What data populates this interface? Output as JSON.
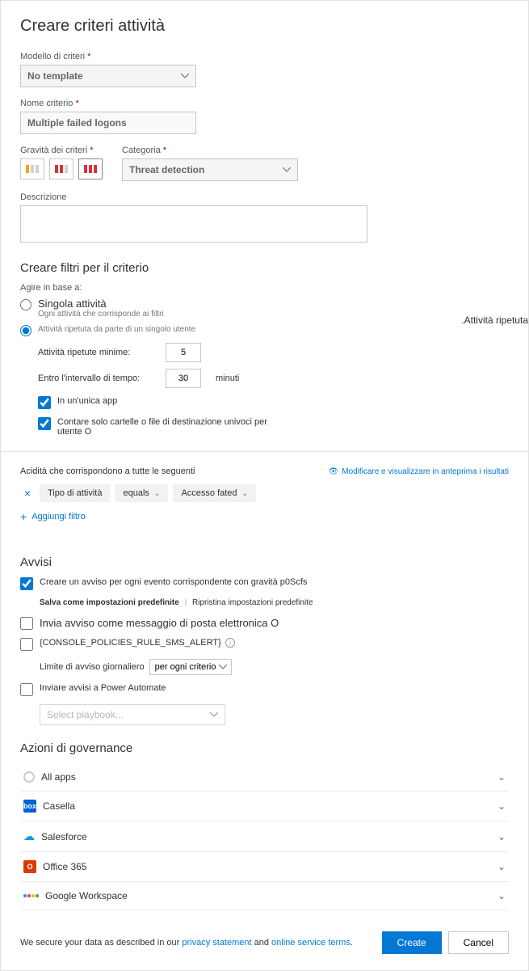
{
  "title": "Creare criteri attività",
  "template": {
    "label": "Modello di criteri",
    "value": "No template"
  },
  "name": {
    "label": "Nome criterio",
    "value": "Multiple failed logons"
  },
  "severity": {
    "label": "Gravità dei criteri"
  },
  "category": {
    "label": "Categoria",
    "value": "Threat detection"
  },
  "description": {
    "label": "Descrizione"
  },
  "filters": {
    "heading": "Creare filtri per il criterio",
    "actOn": "Agire in base a:",
    "single": "Singola attività",
    "singleSub": "Ogni attività che corrisponde ai filtri",
    "repeated": "Attività ripetuta da parte di un singolo utente",
    "minLabel": "Attività ripetute minime:",
    "minValue": "5",
    "withinLabel": "Entro l'intervallo di tempo:",
    "withinValue": "30",
    "withinUnit": "minuti",
    "singleApp": "In un'unica app",
    "uniqueTargets": "Contare solo cartelle o file di destinazione univoci per utente O",
    "rightTag": ".Attività ripetuta",
    "matchHeading": "Acidità che corrispondono a tutte le seguenti",
    "preview": "Modificare e visualizzare in anteprima i risultati",
    "chipType": "Tipo di attività",
    "chipOp": "equals",
    "chipVal": "Accesso fated",
    "addFilter": "Aggiungi filtro"
  },
  "alerts": {
    "heading": "Avvisi",
    "createAlert": "Creare un avviso per ogni evento corrispondente con gravità p0Scfs",
    "saveDefault": "Salva come impostazioni predefinite",
    "restoreDefault": "Ripristina impostazioni predefinite",
    "email": "Invia avviso come messaggio di posta elettronica O",
    "sms": "{CONSOLE_POLICIES_RULE_SMS_ALERT}",
    "dailyLimit": "Limite di avviso giornaliero",
    "perPolicy": "per ogni criterio",
    "powerAutomate": "Inviare avvisi a Power Automate",
    "playbookPlaceholder": "Select playbook..."
  },
  "gov": {
    "heading": "Azioni di governance",
    "items": [
      "All apps",
      "Casella",
      "Salesforce",
      "Office  365",
      "Google Workspace"
    ]
  },
  "footer": {
    "text1": "We secure your data as described in our ",
    "privacy": "privacy statement",
    "and": " and ",
    "terms": "online service terms",
    "create": "Create",
    "cancel": "Cancel"
  }
}
